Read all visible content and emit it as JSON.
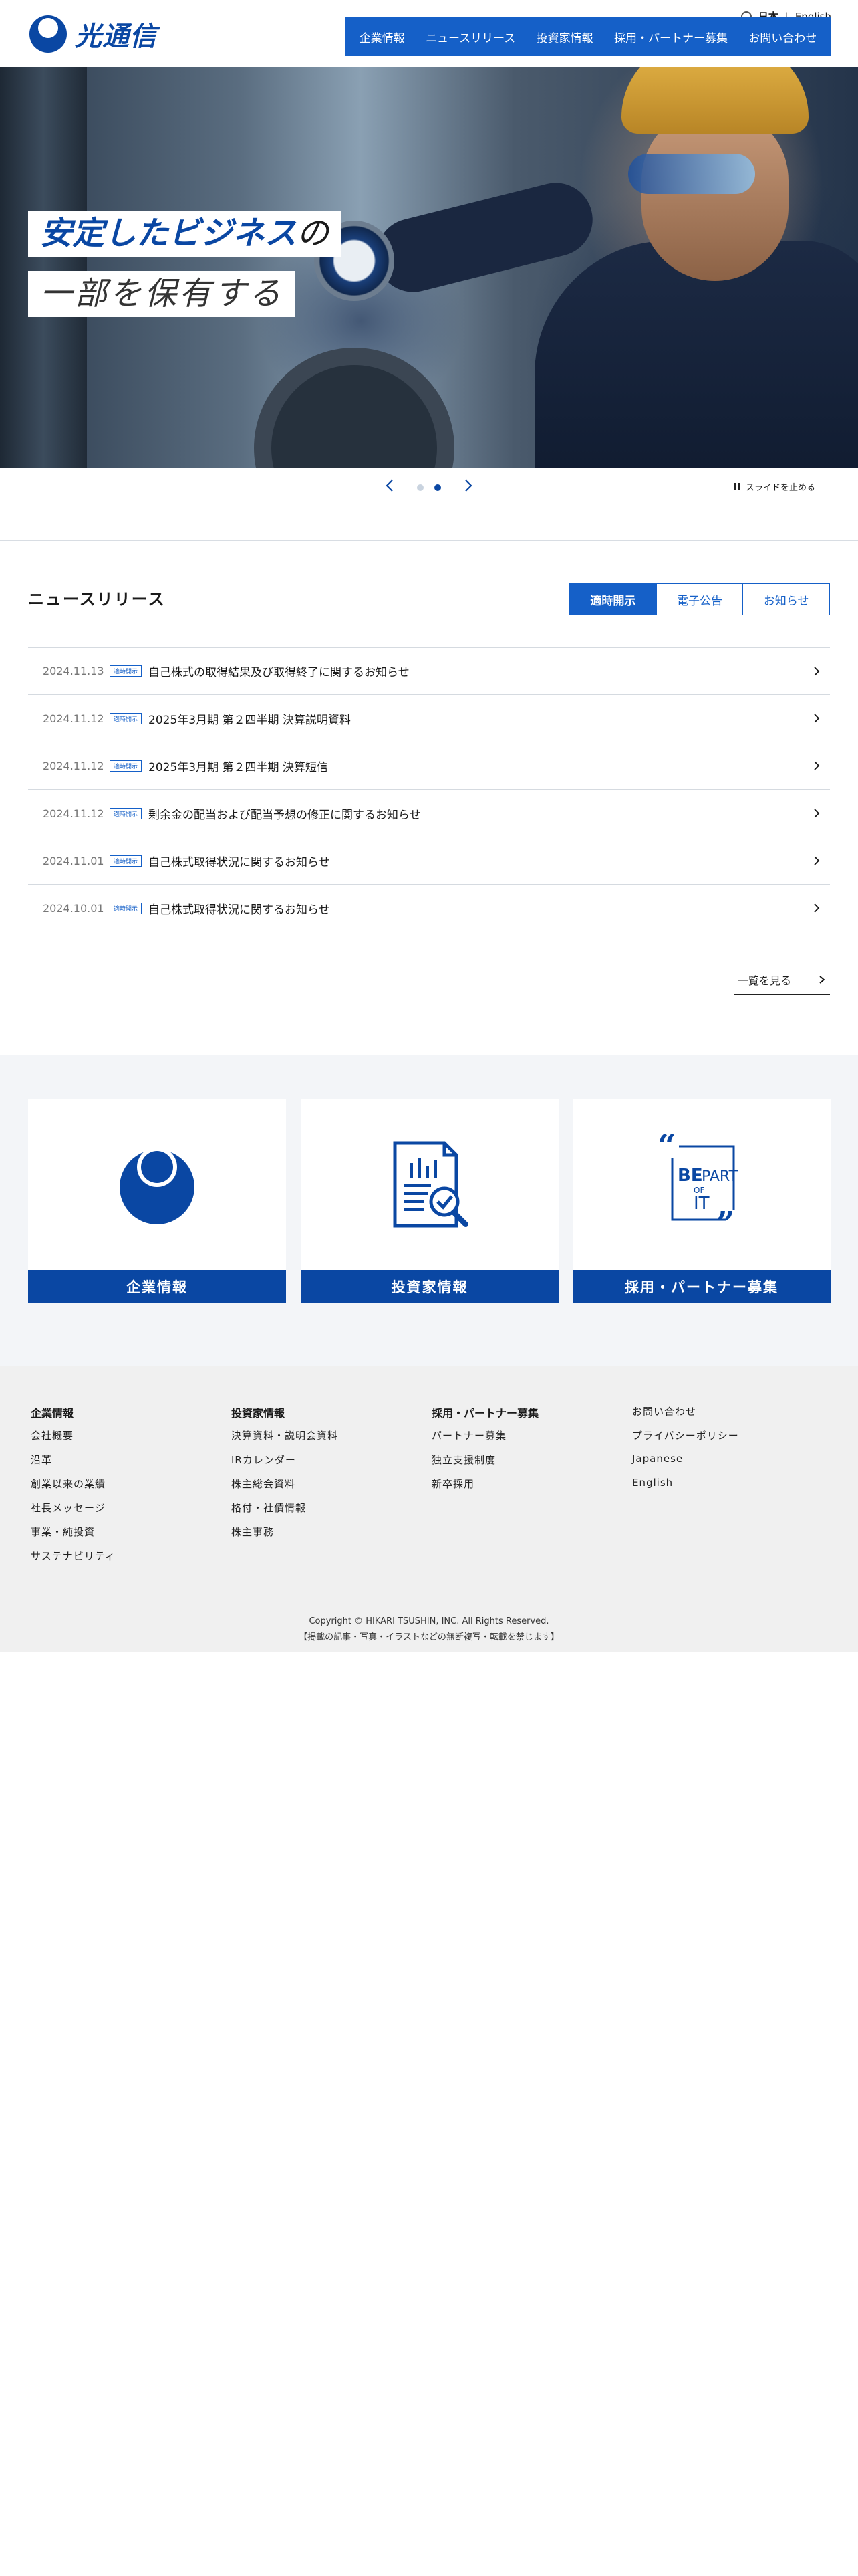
{
  "header": {
    "logo_text": "光通信",
    "lang": {
      "ja": "日本",
      "sep": "|",
      "en": "English"
    },
    "nav": [
      "企業情報",
      "ニュースリリース",
      "投資家情報",
      "採用・パートナー募集",
      "お問い合わせ"
    ]
  },
  "hero": {
    "line1_main": "安定したビジネス",
    "line1_suffix": "の",
    "line2": "一部を保有する"
  },
  "slider": {
    "total_slides": 2,
    "active_slide": 2,
    "pause_label": "スライドを止める"
  },
  "news": {
    "title": "ニュースリリース",
    "tabs": [
      "適時開示",
      "電子公告",
      "お知らせ"
    ],
    "active_tab": "適時開示",
    "items": [
      {
        "date": "2024.11.13",
        "badge": "適時開示",
        "text": "自己株式の取得結果及び取得終了に関するお知らせ"
      },
      {
        "date": "2024.11.12",
        "badge": "適時開示",
        "text": "2025年3月期 第２四半期 決算説明資料"
      },
      {
        "date": "2024.11.12",
        "badge": "適時開示",
        "text": "2025年3月期 第２四半期 決算短信"
      },
      {
        "date": "2024.11.12",
        "badge": "適時開示",
        "text": "剰余金の配当および配当予想の修正に関するお知らせ"
      },
      {
        "date": "2024.11.01",
        "badge": "適時開示",
        "text": "自己株式取得状況に関するお知らせ"
      },
      {
        "date": "2024.10.01",
        "badge": "適時開示",
        "text": "自己株式取得状況に関するお知らせ"
      }
    ],
    "more_label": "一覧を見る"
  },
  "cards": [
    {
      "label": "企業情報",
      "icon": "company-logo-icon"
    },
    {
      "label": "投資家情報",
      "icon": "document-check-icon"
    },
    {
      "label": "採用・パートナー募集",
      "icon": "be-part-of-it-icon",
      "icon_text": {
        "be": "BE",
        "part": "PART",
        "of": "OF",
        "it": "IT"
      }
    }
  ],
  "footer": {
    "columns": [
      {
        "head": "企業情報",
        "links": [
          "会社概要",
          "沿革",
          "創業以来の業績",
          "社長メッセージ",
          "事業・純投資",
          "サステナビリティ"
        ]
      },
      {
        "head": "投資家情報",
        "links": [
          "決算資料・説明会資料",
          "IRカレンダー",
          "株主総会資料",
          "格付・社債情報",
          "株主事務"
        ]
      },
      {
        "head": "採用・パートナー募集",
        "links": [
          "パートナー募集",
          "独立支援制度",
          "新卒採用"
        ]
      },
      {
        "head": "",
        "links": [
          "お問い合わせ",
          "プライバシーポリシー",
          "Japanese",
          "English"
        ]
      }
    ],
    "copyright": "Copyright © HIKARI TSUSHIN, INC. All Rights Reserved.",
    "notice": "【掲載の記事・写真・イラストなどの無断複写・転載を禁じます】"
  },
  "colors": {
    "brand": "#0a47a3",
    "nav": "#1560c8",
    "footer_bg": "#f0f0f0"
  }
}
